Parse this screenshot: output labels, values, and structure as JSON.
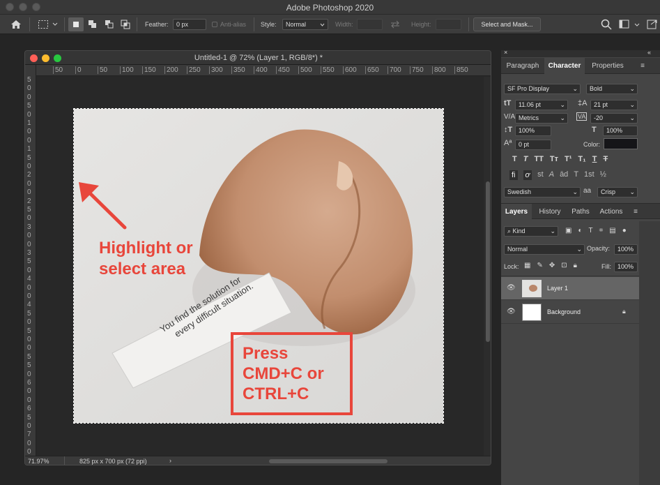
{
  "app": {
    "title": "Adobe Photoshop 2020"
  },
  "options": {
    "feather_label": "Feather:",
    "feather_value": "0 px",
    "antialias_label": "Anti-alias",
    "style_label": "Style:",
    "style_value": "Normal",
    "width_label": "Width:",
    "height_label": "Height:",
    "select_mask_label": "Select and Mask..."
  },
  "document": {
    "title": "Untitled-1 @ 72% (Layer 1, RGB/8*) *",
    "hruler_ticks": [
      "50",
      "0",
      "50",
      "100",
      "150",
      "200",
      "250",
      "300",
      "350",
      "400",
      "450",
      "500",
      "550",
      "600",
      "650",
      "700",
      "750",
      "800",
      "850"
    ],
    "vruler_ticks": [
      "5",
      "0",
      "0",
      "5",
      "0",
      "1",
      "0",
      "0",
      "1",
      "5",
      "0",
      "2",
      "0",
      "0",
      "2",
      "5",
      "0",
      "3",
      "0",
      "0",
      "3",
      "5",
      "0",
      "4",
      "0",
      "0",
      "4",
      "5",
      "0",
      "5",
      "0",
      "0",
      "5",
      "5",
      "0",
      "6",
      "0",
      "0",
      "6",
      "5",
      "0",
      "7",
      "0",
      "0"
    ],
    "zoom": "71.97%",
    "doc_info": "825 px x 700 px (72 ppi)"
  },
  "image": {
    "annotation1_line1": "Highlight or",
    "annotation1_line2": "select area",
    "annotation2_line1": "Press",
    "annotation2_line2": "CMD+C or",
    "annotation2_line3": "CTRL+C",
    "fortune_line1": "You find the solution for",
    "fortune_line2": "every difficult situation."
  },
  "character_panel": {
    "tabs": [
      "Paragraph",
      "Character",
      "Properties"
    ],
    "active_tab": "Character",
    "font_family": "SF Pro Display",
    "font_style": "Bold",
    "font_size": "11.06 pt",
    "leading": "21 pt",
    "kerning": "Metrics",
    "tracking": "-20",
    "vertical_scale": "100%",
    "horizontal_scale": "100%",
    "baseline_shift": "0 pt",
    "color_label": "Color:",
    "color_value": "#151518",
    "style_buttons": [
      "T",
      "T",
      "TT",
      "Tт",
      "T¹",
      "T₁",
      "T",
      "T"
    ],
    "opentype_buttons": [
      "fi",
      "ơ",
      "st",
      "A",
      "ād",
      "T",
      "1st",
      "½"
    ],
    "language": "Swedish",
    "aa_label": "aa",
    "antialias_method": "Crisp"
  },
  "layers_panel": {
    "tabs": [
      "Layers",
      "History",
      "Paths",
      "Actions"
    ],
    "active_tab": "Layers",
    "filter": "Kind",
    "blend_mode": "Normal",
    "opacity_label": "Opacity:",
    "opacity_value": "100%",
    "lock_label": "Lock:",
    "fill_label": "Fill:",
    "fill_value": "100%",
    "layers": [
      {
        "name": "Layer 1",
        "selected": true
      },
      {
        "name": "Background",
        "selected": false
      }
    ]
  },
  "colors": {
    "accent_red": "#e8463b",
    "panel_bg": "#454545",
    "app_bg": "#252525"
  }
}
